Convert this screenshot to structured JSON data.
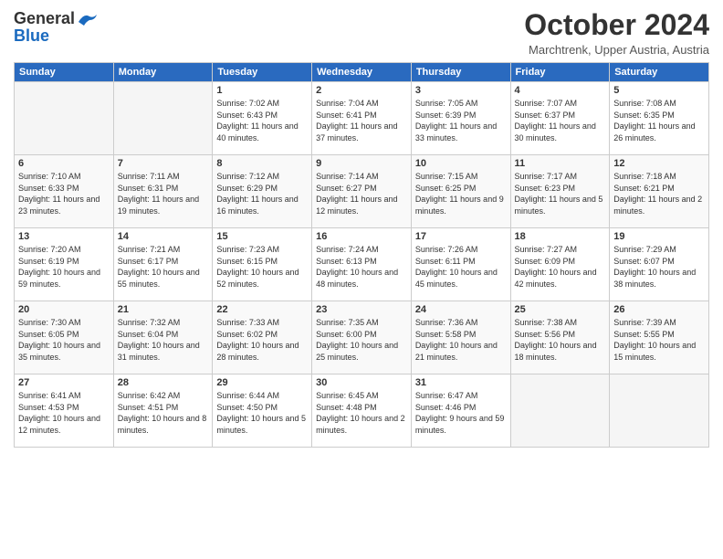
{
  "logo": {
    "line1": "General",
    "line2": "Blue"
  },
  "header": {
    "month_title": "October 2024",
    "subtitle": "Marchtrenk, Upper Austria, Austria"
  },
  "days_of_week": [
    "Sunday",
    "Monday",
    "Tuesday",
    "Wednesday",
    "Thursday",
    "Friday",
    "Saturday"
  ],
  "weeks": [
    [
      {
        "num": "",
        "info": ""
      },
      {
        "num": "",
        "info": ""
      },
      {
        "num": "1",
        "info": "Sunrise: 7:02 AM\nSunset: 6:43 PM\nDaylight: 11 hours and 40 minutes."
      },
      {
        "num": "2",
        "info": "Sunrise: 7:04 AM\nSunset: 6:41 PM\nDaylight: 11 hours and 37 minutes."
      },
      {
        "num": "3",
        "info": "Sunrise: 7:05 AM\nSunset: 6:39 PM\nDaylight: 11 hours and 33 minutes."
      },
      {
        "num": "4",
        "info": "Sunrise: 7:07 AM\nSunset: 6:37 PM\nDaylight: 11 hours and 30 minutes."
      },
      {
        "num": "5",
        "info": "Sunrise: 7:08 AM\nSunset: 6:35 PM\nDaylight: 11 hours and 26 minutes."
      }
    ],
    [
      {
        "num": "6",
        "info": "Sunrise: 7:10 AM\nSunset: 6:33 PM\nDaylight: 11 hours and 23 minutes."
      },
      {
        "num": "7",
        "info": "Sunrise: 7:11 AM\nSunset: 6:31 PM\nDaylight: 11 hours and 19 minutes."
      },
      {
        "num": "8",
        "info": "Sunrise: 7:12 AM\nSunset: 6:29 PM\nDaylight: 11 hours and 16 minutes."
      },
      {
        "num": "9",
        "info": "Sunrise: 7:14 AM\nSunset: 6:27 PM\nDaylight: 11 hours and 12 minutes."
      },
      {
        "num": "10",
        "info": "Sunrise: 7:15 AM\nSunset: 6:25 PM\nDaylight: 11 hours and 9 minutes."
      },
      {
        "num": "11",
        "info": "Sunrise: 7:17 AM\nSunset: 6:23 PM\nDaylight: 11 hours and 5 minutes."
      },
      {
        "num": "12",
        "info": "Sunrise: 7:18 AM\nSunset: 6:21 PM\nDaylight: 11 hours and 2 minutes."
      }
    ],
    [
      {
        "num": "13",
        "info": "Sunrise: 7:20 AM\nSunset: 6:19 PM\nDaylight: 10 hours and 59 minutes."
      },
      {
        "num": "14",
        "info": "Sunrise: 7:21 AM\nSunset: 6:17 PM\nDaylight: 10 hours and 55 minutes."
      },
      {
        "num": "15",
        "info": "Sunrise: 7:23 AM\nSunset: 6:15 PM\nDaylight: 10 hours and 52 minutes."
      },
      {
        "num": "16",
        "info": "Sunrise: 7:24 AM\nSunset: 6:13 PM\nDaylight: 10 hours and 48 minutes."
      },
      {
        "num": "17",
        "info": "Sunrise: 7:26 AM\nSunset: 6:11 PM\nDaylight: 10 hours and 45 minutes."
      },
      {
        "num": "18",
        "info": "Sunrise: 7:27 AM\nSunset: 6:09 PM\nDaylight: 10 hours and 42 minutes."
      },
      {
        "num": "19",
        "info": "Sunrise: 7:29 AM\nSunset: 6:07 PM\nDaylight: 10 hours and 38 minutes."
      }
    ],
    [
      {
        "num": "20",
        "info": "Sunrise: 7:30 AM\nSunset: 6:05 PM\nDaylight: 10 hours and 35 minutes."
      },
      {
        "num": "21",
        "info": "Sunrise: 7:32 AM\nSunset: 6:04 PM\nDaylight: 10 hours and 31 minutes."
      },
      {
        "num": "22",
        "info": "Sunrise: 7:33 AM\nSunset: 6:02 PM\nDaylight: 10 hours and 28 minutes."
      },
      {
        "num": "23",
        "info": "Sunrise: 7:35 AM\nSunset: 6:00 PM\nDaylight: 10 hours and 25 minutes."
      },
      {
        "num": "24",
        "info": "Sunrise: 7:36 AM\nSunset: 5:58 PM\nDaylight: 10 hours and 21 minutes."
      },
      {
        "num": "25",
        "info": "Sunrise: 7:38 AM\nSunset: 5:56 PM\nDaylight: 10 hours and 18 minutes."
      },
      {
        "num": "26",
        "info": "Sunrise: 7:39 AM\nSunset: 5:55 PM\nDaylight: 10 hours and 15 minutes."
      }
    ],
    [
      {
        "num": "27",
        "info": "Sunrise: 6:41 AM\nSunset: 4:53 PM\nDaylight: 10 hours and 12 minutes."
      },
      {
        "num": "28",
        "info": "Sunrise: 6:42 AM\nSunset: 4:51 PM\nDaylight: 10 hours and 8 minutes."
      },
      {
        "num": "29",
        "info": "Sunrise: 6:44 AM\nSunset: 4:50 PM\nDaylight: 10 hours and 5 minutes."
      },
      {
        "num": "30",
        "info": "Sunrise: 6:45 AM\nSunset: 4:48 PM\nDaylight: 10 hours and 2 minutes."
      },
      {
        "num": "31",
        "info": "Sunrise: 6:47 AM\nSunset: 4:46 PM\nDaylight: 9 hours and 59 minutes."
      },
      {
        "num": "",
        "info": ""
      },
      {
        "num": "",
        "info": ""
      }
    ]
  ]
}
